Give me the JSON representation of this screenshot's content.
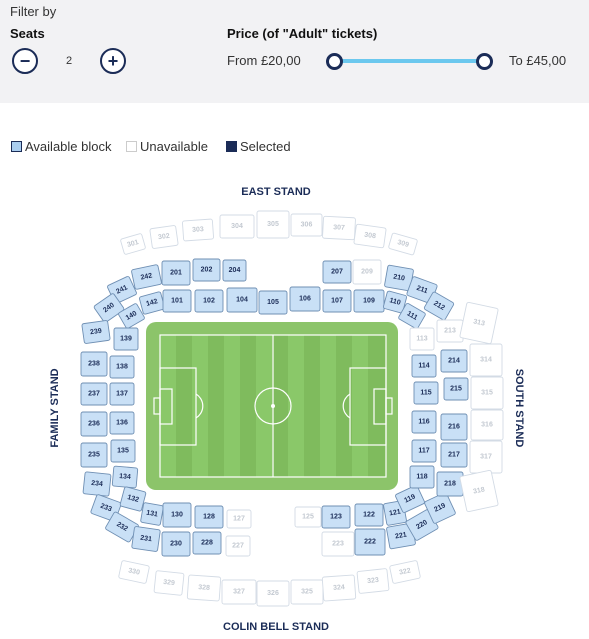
{
  "filter": {
    "title": "Filter by",
    "seats_label": "Seats",
    "seat_count": "2",
    "minus_symbol": "−",
    "plus_symbol": "+",
    "price_label": "Price (of \"Adult\" tickets)",
    "price_from": "From £20,00",
    "price_to": "To £45,00"
  },
  "legend": {
    "available": "Available block",
    "unavailable": "Unavailable",
    "selected": "Selected"
  },
  "stands": {
    "east": "EAST STAND",
    "family": "FAMILY STAND",
    "south": "SOUTH STAND",
    "colin_bell": "COLIN BELL STAND"
  },
  "colors": {
    "accent": "#1b2c57",
    "available_fill": "#c9e0f6",
    "slider": "#6cc8ee",
    "pitch": "#8cc46a"
  },
  "blocks": [
    {
      "id": "301",
      "available": false
    },
    {
      "id": "302",
      "available": false
    },
    {
      "id": "303",
      "available": false
    },
    {
      "id": "304",
      "available": false
    },
    {
      "id": "305",
      "available": false
    },
    {
      "id": "306",
      "available": false
    },
    {
      "id": "307",
      "available": false
    },
    {
      "id": "308",
      "available": false
    },
    {
      "id": "309",
      "available": false
    },
    {
      "id": "242",
      "available": true
    },
    {
      "id": "201",
      "available": true
    },
    {
      "id": "202",
      "available": true
    },
    {
      "id": "204",
      "available": true
    },
    {
      "id": "207",
      "available": true
    },
    {
      "id": "209",
      "available": false
    },
    {
      "id": "210",
      "available": true
    },
    {
      "id": "211",
      "available": true
    },
    {
      "id": "212",
      "available": true
    },
    {
      "id": "241",
      "available": true
    },
    {
      "id": "240",
      "available": true
    },
    {
      "id": "140",
      "available": true
    },
    {
      "id": "142",
      "available": true
    },
    {
      "id": "101",
      "available": true
    },
    {
      "id": "102",
      "available": true
    },
    {
      "id": "104",
      "available": true
    },
    {
      "id": "105",
      "available": true
    },
    {
      "id": "106",
      "available": true
    },
    {
      "id": "107",
      "available": true
    },
    {
      "id": "109",
      "available": true
    },
    {
      "id": "110",
      "available": true
    },
    {
      "id": "111",
      "available": true
    },
    {
      "id": "239",
      "available": true
    },
    {
      "id": "139",
      "available": true
    },
    {
      "id": "238",
      "available": true
    },
    {
      "id": "138",
      "available": true
    },
    {
      "id": "237",
      "available": true
    },
    {
      "id": "137",
      "available": true
    },
    {
      "id": "236",
      "available": true
    },
    {
      "id": "136",
      "available": true
    },
    {
      "id": "235",
      "available": true
    },
    {
      "id": "135",
      "available": true
    },
    {
      "id": "234",
      "available": true
    },
    {
      "id": "134",
      "available": true
    },
    {
      "id": "233",
      "available": true
    },
    {
      "id": "132",
      "available": true
    },
    {
      "id": "232",
      "available": true
    },
    {
      "id": "131",
      "available": true
    },
    {
      "id": "231",
      "available": true
    },
    {
      "id": "130",
      "available": true
    },
    {
      "id": "128",
      "available": true
    },
    {
      "id": "127",
      "available": false
    },
    {
      "id": "230",
      "available": true
    },
    {
      "id": "228",
      "available": true
    },
    {
      "id": "227",
      "available": false
    },
    {
      "id": "125",
      "available": false
    },
    {
      "id": "123",
      "available": true
    },
    {
      "id": "122",
      "available": true
    },
    {
      "id": "121",
      "available": true
    },
    {
      "id": "223",
      "available": false
    },
    {
      "id": "222",
      "available": true
    },
    {
      "id": "221",
      "available": true
    },
    {
      "id": "220",
      "available": true
    },
    {
      "id": "219",
      "available": true
    },
    {
      "id": "119",
      "available": true
    },
    {
      "id": "218",
      "available": true
    },
    {
      "id": "118",
      "available": true
    },
    {
      "id": "217",
      "available": true
    },
    {
      "id": "117",
      "available": true
    },
    {
      "id": "216",
      "available": true
    },
    {
      "id": "116",
      "available": true
    },
    {
      "id": "215",
      "available": true
    },
    {
      "id": "115",
      "available": true
    },
    {
      "id": "214",
      "available": true
    },
    {
      "id": "114",
      "available": true
    },
    {
      "id": "213",
      "available": false
    },
    {
      "id": "113",
      "available": false
    },
    {
      "id": "313",
      "available": false
    },
    {
      "id": "314",
      "available": false
    },
    {
      "id": "315",
      "available": false
    },
    {
      "id": "316",
      "available": false
    },
    {
      "id": "317",
      "available": false
    },
    {
      "id": "318",
      "available": false
    },
    {
      "id": "330",
      "available": false
    },
    {
      "id": "329",
      "available": false
    },
    {
      "id": "328",
      "available": false
    },
    {
      "id": "327",
      "available": false
    },
    {
      "id": "326",
      "available": false
    },
    {
      "id": "325",
      "available": false
    },
    {
      "id": "324",
      "available": false
    },
    {
      "id": "323",
      "available": false
    },
    {
      "id": "322",
      "available": false
    }
  ]
}
